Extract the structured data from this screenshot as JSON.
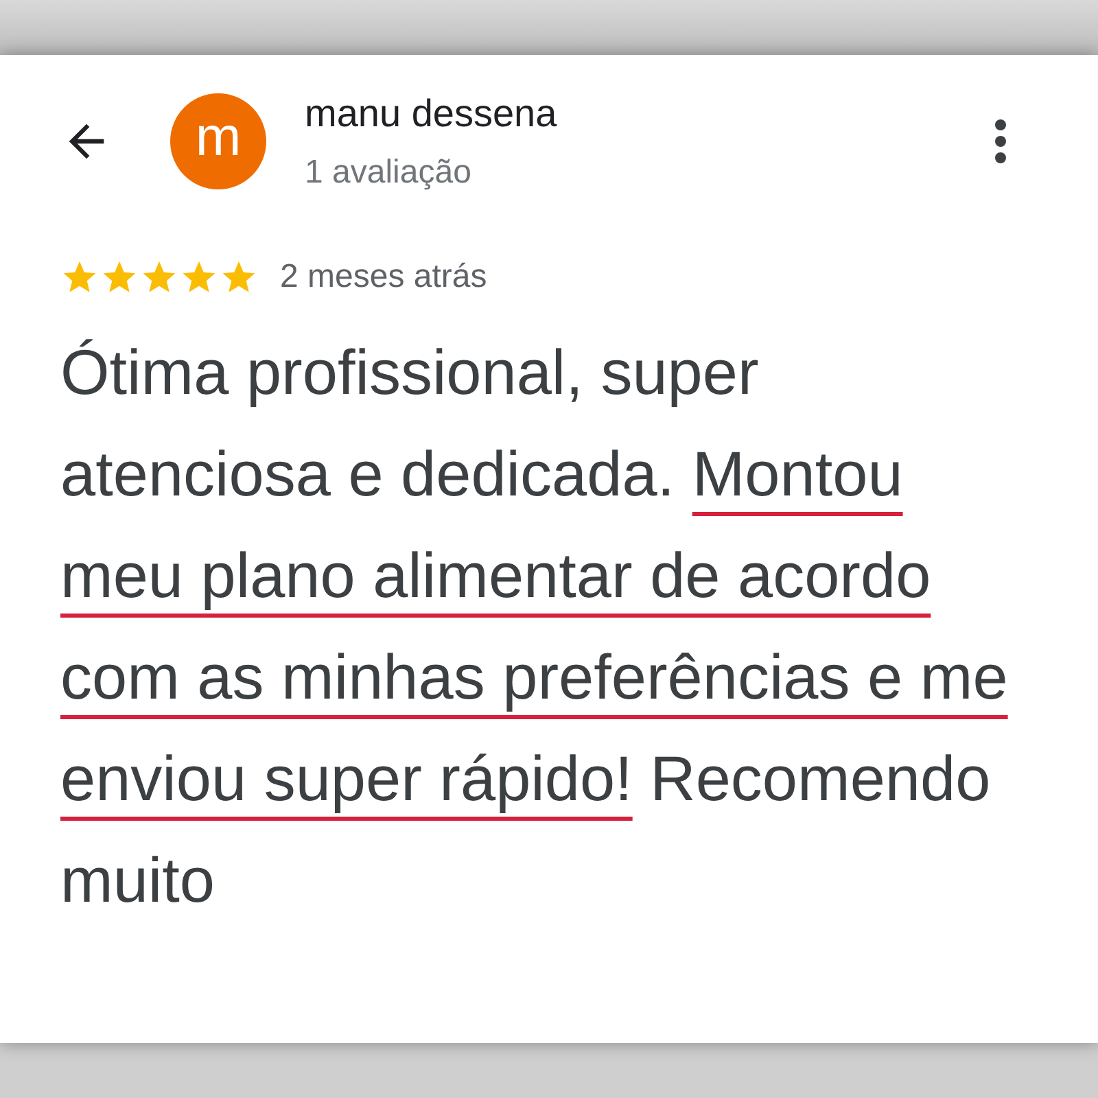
{
  "header": {
    "avatar_letter": "m",
    "name": "manu dessena",
    "review_count": "1 avaliação"
  },
  "review": {
    "stars": 5,
    "time": "2 meses atrás",
    "segments": [
      {
        "text": "Ótima profissional, super atenciosa e dedicada. ",
        "underlined": false
      },
      {
        "text": "Montou meu plano alimentar de acordo com as minhas preferências e me enviou super rápido!",
        "underlined": true
      },
      {
        "text": " Recomendo muito",
        "underlined": false
      }
    ]
  }
}
